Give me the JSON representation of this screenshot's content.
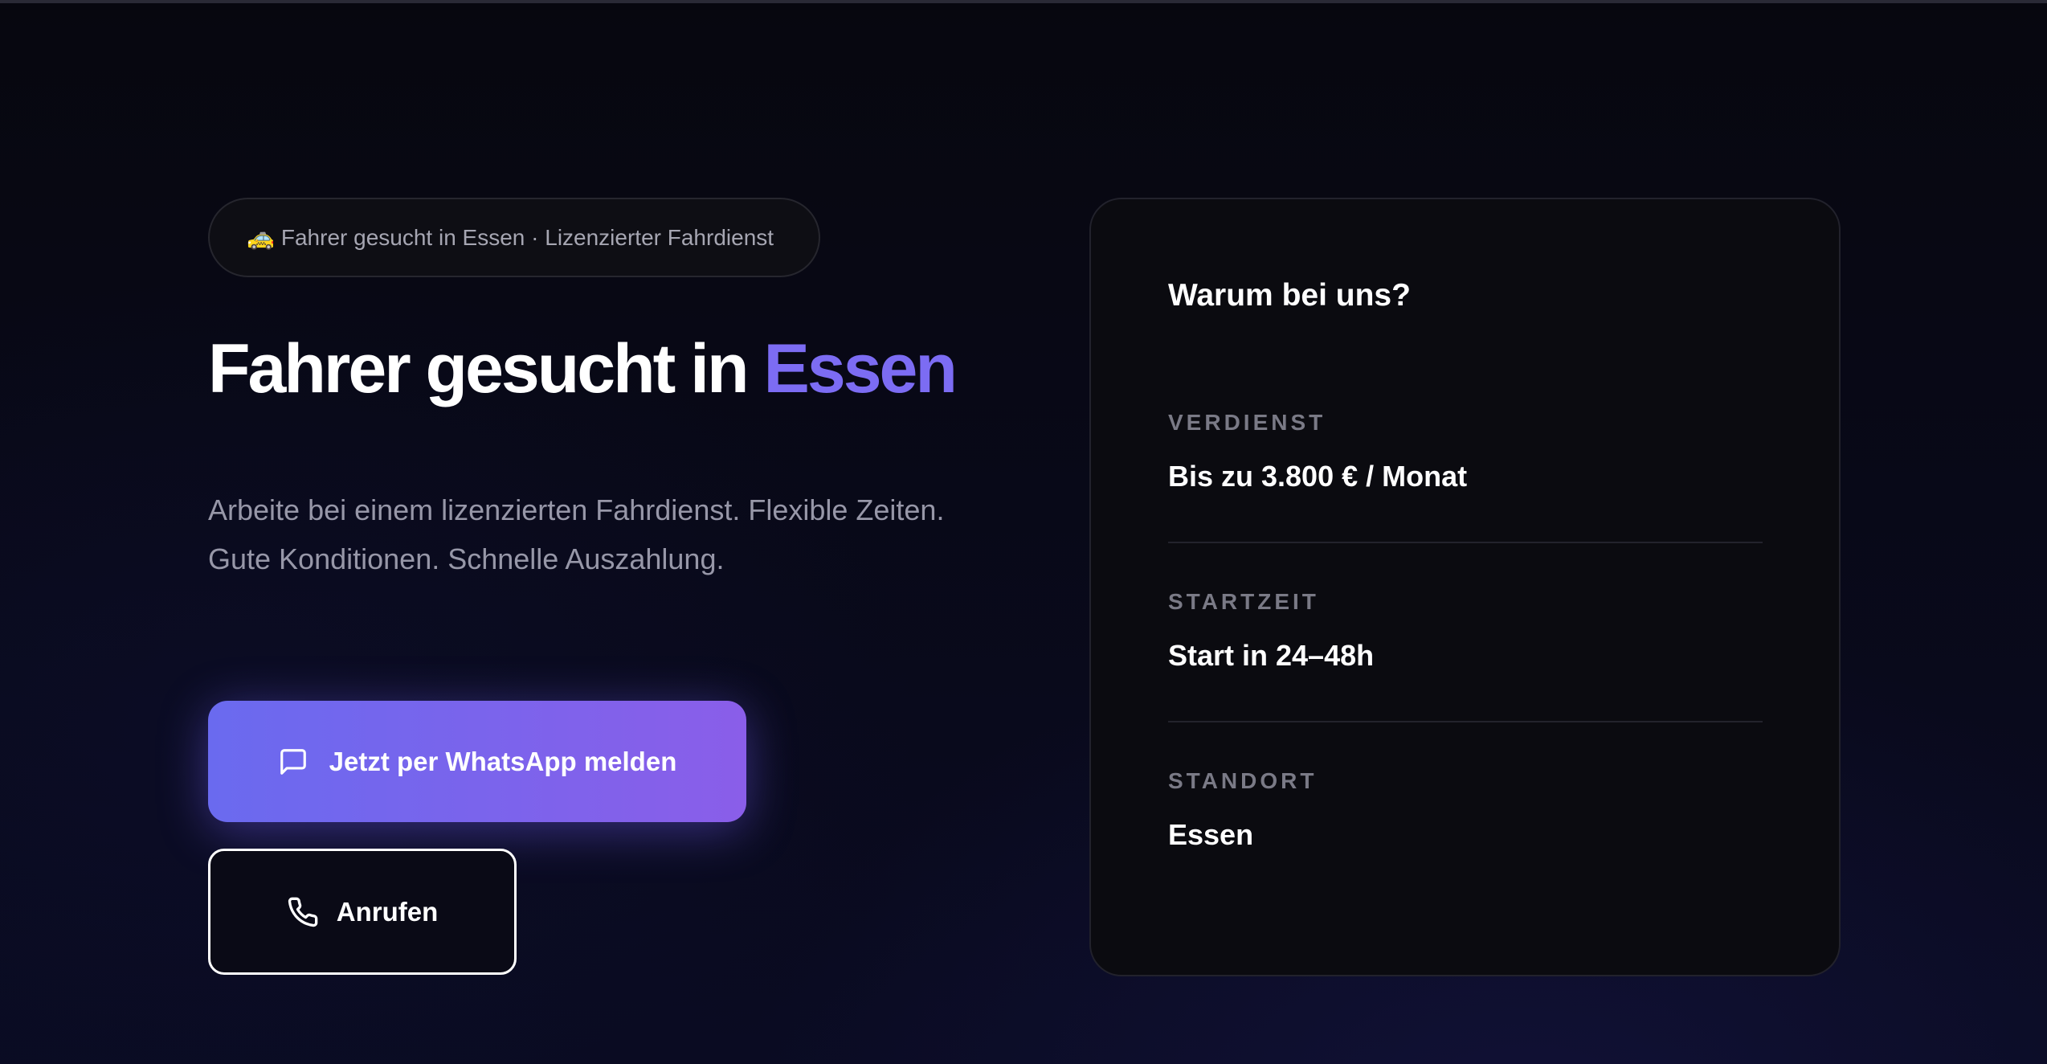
{
  "hero": {
    "badge": {
      "emoji": "🚕",
      "text": "Fahrer gesucht in Essen · Lizenzierter Fahrdienst"
    },
    "headline": {
      "main": "Fahrer gesucht in ",
      "accent": "Essen"
    },
    "subtext": {
      "line1": "Arbeite bei einem lizenzierten Fahrdienst. Flexible Zeiten.",
      "line2": "Gute Konditionen. Schnelle Auszahlung."
    },
    "buttons": {
      "whatsapp_label": "Jetzt per WhatsApp melden",
      "whatsapp_icon": "message-icon",
      "call_label": "Anrufen",
      "call_icon": "phone-icon"
    }
  },
  "card": {
    "title": "Warum bei uns?",
    "rows": [
      {
        "label": "VERDIENST",
        "value": "Bis zu 3.800 € / Monat"
      },
      {
        "label": "STARTZEIT",
        "value": "Start in 24–48h"
      },
      {
        "label": "STANDORT",
        "value": "Essen"
      }
    ]
  },
  "colors": {
    "accent": "#7c6cf3",
    "button_gradient_start": "#6a6aef",
    "button_gradient_end": "#8a5ee9",
    "background": "#08081a"
  }
}
